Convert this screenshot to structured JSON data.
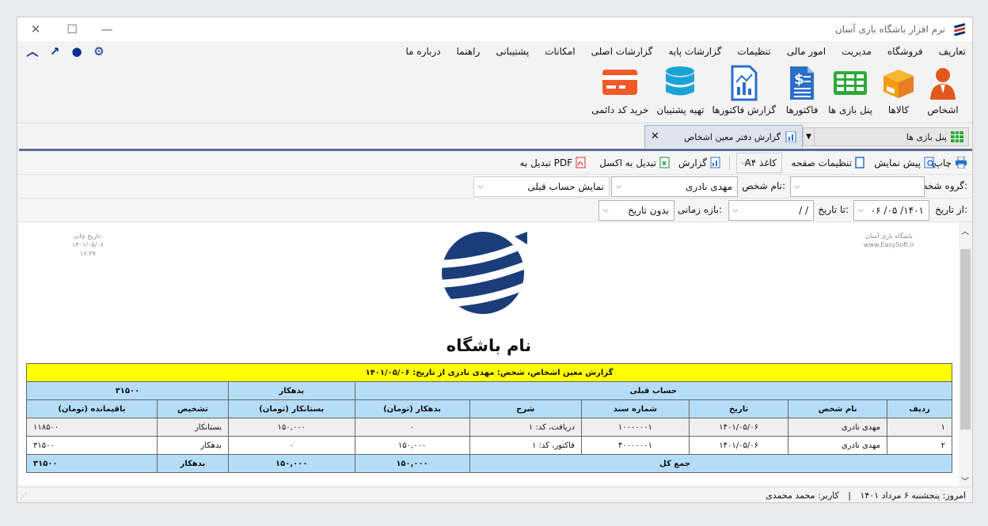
{
  "app": {
    "title": "نرم افزار باشگاه بازی آسان"
  },
  "menu": [
    "تعاریف",
    "فروشگاه",
    "مدیریت",
    "امور مالی",
    "تنظیمات",
    "گزارشات پایه",
    "گزارشات اصلی",
    "امکانات",
    "پشتیبانی",
    "راهنما",
    "درباره ما"
  ],
  "quick_icons": [
    "gear-icon",
    "user-icon",
    "share-arrow-icon",
    "collapse-icon"
  ],
  "ribbon": [
    {
      "label": "اشخاص",
      "icon": "person-icon",
      "color": "#e2571e"
    },
    {
      "label": "کالاها",
      "icon": "box-icon",
      "color": "#f39c12"
    },
    {
      "label": "پنل بازی ها",
      "icon": "grid-icon",
      "color": "#2eaa3a"
    },
    {
      "label": "فاکتورها",
      "icon": "invoice-icon",
      "color": "#2a6fc9"
    },
    {
      "label": "گزارش فاکتورها",
      "icon": "report-icon",
      "color": "#2a6fc9"
    },
    {
      "label": "تهیه پشتیبان",
      "icon": "database-icon",
      "color": "#1ba3d8"
    },
    {
      "label": "خرید کد دائمی",
      "icon": "card-icon",
      "color": "#f05a28"
    }
  ],
  "tabs": [
    {
      "label": "پنل بازی ها"
    },
    {
      "label": "گزارش دفتر معین اشخاص"
    }
  ],
  "toolbar": {
    "print": "چاپ",
    "preview": "پیش نمایش",
    "page_settings": "تنظیمات صفحه",
    "paper": "کاغذ A۴",
    "report": "گزارش",
    "excel": "تبدیل به اکسل",
    "pdf": "تبدیل به PDF"
  },
  "filters": {
    "group_label": "گروه شخص:",
    "group_value": "",
    "person_label": "نام شخص:",
    "person_value": "مهدی نادری",
    "prev_account": "نمایش حساب قبلی",
    "from_label": "از تاریخ:",
    "from_value": "۱۴۰۱/ ۰۵/ ۰۶",
    "to_label": "تا تاریخ:",
    "to_value": "/        /",
    "range_label": "بازه زمانی:",
    "range_value": "بدون تاریخ"
  },
  "report": {
    "print_date_label": "تاریخ چاپ:",
    "print_date": "۱۴۰۱/۰۵/۰۶",
    "print_time": "۱۶:۳۷",
    "brand_line1": "باشگاه بازی آسان",
    "brand_line2": "www.EasySoft.ir",
    "club_name": "نام باشگاه",
    "heading": "گزارش معین اشخاص، شخص: مهدی نادری از تاریخ: ۱۴۰۱/۰۵/۰۶",
    "prev_label": "حساب قبلی",
    "prev_status": "بدهکار",
    "prev_amount": "۳۱۵۰۰",
    "columns": [
      "ردیف",
      "نام شخص",
      "تاریخ",
      "شماره سند",
      "شرح",
      "بدهکار (تومان)",
      "بستانکار (تومان)",
      "تشخیص",
      "باقیمانده (تومان)"
    ],
    "rows": [
      [
        "۱",
        "مهدی نادری",
        "۱۴۰۱/۰۵/۰۶",
        "۱۰۰۰۰۰۰۱",
        "دریافت، کد: ۱",
        "۰",
        "۱۵۰,۰۰۰",
        "بستانکار",
        "۱۱۸۵۰۰"
      ],
      [
        "۲",
        "مهدی نادری",
        "۱۴۰۱/۰۵/۰۶",
        "۴۰۰۰۰۰۰۱",
        "فاکتور، کد: ۱",
        "۱۵۰,۰۰۰",
        "۰",
        "بدهکار",
        "۳۱۵۰۰"
      ]
    ],
    "total_label": "جمع کل",
    "total_debit": "۱۵۰,۰۰۰",
    "total_credit": "۱۵۰,۰۰۰",
    "total_status": "بدهکار",
    "total_balance": "۳۱۵۰۰"
  },
  "status": {
    "today": "امروز: پنجشنبه ۶ مرداد ۱۴۰۱",
    "user": "کاربر: محمد محمدی"
  }
}
